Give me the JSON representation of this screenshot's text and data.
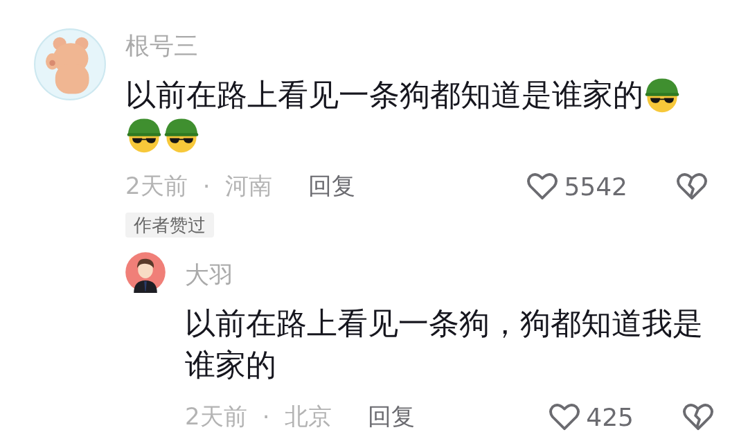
{
  "comments": [
    {
      "author": "根号三",
      "content": [
        {
          "kind": "text",
          "text": "以前在路上看见一条狗都知道是谁家的"
        },
        {
          "kind": "emoji"
        },
        {
          "kind": "emoji"
        },
        {
          "kind": "emoji"
        }
      ],
      "time": "2天前",
      "separator": "·",
      "location": "河南",
      "reply_label": "回复",
      "likes": "5542",
      "tag": "作者赞过",
      "replies": [
        {
          "author": "大羽",
          "content": [
            {
              "kind": "text",
              "text": "以前在路上看见一条狗，狗都知道我是谁家的"
            }
          ],
          "time": "2天前",
          "separator": "·",
          "location": "北京",
          "reply_label": "回复",
          "likes": "425"
        }
      ]
    }
  ]
}
